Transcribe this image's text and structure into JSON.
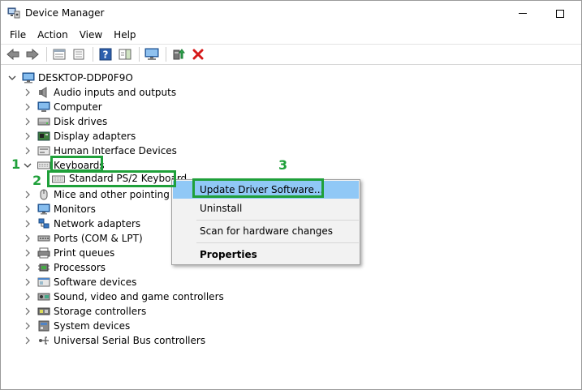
{
  "window": {
    "title": "Device Manager"
  },
  "menu": [
    "File",
    "Action",
    "View",
    "Help"
  ],
  "toolbar": {
    "icons": [
      "back-icon",
      "forward-icon",
      "properties-icon",
      "show-hide-icon",
      "help-icon",
      "action-pane-icon",
      "monitor-icon",
      "update-driver-icon",
      "uninstall-icon"
    ]
  },
  "tree": {
    "root": "DESKTOP-DDP0F9O",
    "categories": [
      "Audio inputs and outputs",
      "Computer",
      "Disk drives",
      "Display adapters",
      "Human Interface Devices",
      "Keyboards",
      "Mice and other pointing de",
      "Monitors",
      "Network adapters",
      "Ports (COM & LPT)",
      "Print queues",
      "Processors",
      "Software devices",
      "Sound, video and game controllers",
      "Storage controllers",
      "System devices",
      "Universal Serial Bus controllers"
    ],
    "keyboard_child": "Standard PS/2 Keyboard"
  },
  "context_menu": {
    "items": [
      "Update Driver Software...",
      "Uninstall",
      "Scan for hardware changes",
      "Properties"
    ]
  },
  "annotations": {
    "step1": "1",
    "step2": "2",
    "step3": "3"
  },
  "colors": {
    "annotation": "#1fa03a",
    "highlight": "#90c8f6"
  }
}
